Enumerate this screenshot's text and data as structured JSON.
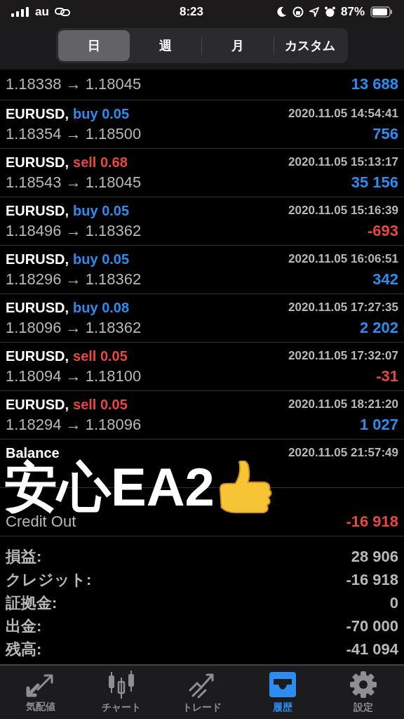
{
  "status_bar": {
    "carrier": "au",
    "time": "8:23",
    "battery": "87%"
  },
  "period_tabs": [
    {
      "label": "日",
      "selected": true
    },
    {
      "label": "週",
      "selected": false
    },
    {
      "label": "月",
      "selected": false
    },
    {
      "label": "カスタム",
      "selected": false
    }
  ],
  "partial_row": {
    "prices": "1.18338 → 1.18045",
    "profit": "13 688",
    "loss": false
  },
  "trades": [
    {
      "kind": "trade",
      "symbol": "EURUSD,",
      "sell": false,
      "volume": "buy 0.05",
      "time": "2020.11.05 14:54:41",
      "prices": "1.18354 → 1.18500",
      "profit": "756",
      "loss": false
    },
    {
      "kind": "trade",
      "symbol": "EURUSD,",
      "sell": true,
      "volume": "sell 0.68",
      "time": "2020.11.05 15:13:17",
      "prices": "1.18543 → 1.18045",
      "profit": "35 156",
      "loss": false
    },
    {
      "kind": "trade",
      "symbol": "EURUSD,",
      "sell": false,
      "volume": "buy 0.05",
      "time": "2020.11.05 15:16:39",
      "prices": "1.18496 → 1.18362",
      "profit": "-693",
      "loss": true
    },
    {
      "kind": "trade",
      "symbol": "EURUSD,",
      "sell": false,
      "volume": "buy 0.05",
      "time": "2020.11.05 16:06:51",
      "prices": "1.18296 → 1.18362",
      "profit": "342",
      "loss": false
    },
    {
      "kind": "trade",
      "symbol": "EURUSD,",
      "sell": false,
      "volume": "buy 0.08",
      "time": "2020.11.05 17:27:35",
      "prices": "1.18096 → 1.18362",
      "profit": "2 202",
      "loss": false
    },
    {
      "kind": "trade",
      "symbol": "EURUSD,",
      "sell": true,
      "volume": "sell 0.05",
      "time": "2020.11.05 17:32:07",
      "prices": "1.18094 → 1.18100",
      "profit": "-31",
      "loss": true
    },
    {
      "kind": "trade",
      "symbol": "EURUSD,",
      "sell": true,
      "volume": "sell 0.05",
      "time": "2020.11.05 18:21:20",
      "prices": "1.18294 → 1.18096",
      "profit": "1 027",
      "loss": false
    },
    {
      "kind": "balance",
      "symbol": "Balance",
      "time": "2020.11.05 21:57:49"
    },
    {
      "kind": "balance",
      "prices": "Credit Out",
      "profit": "-16 918",
      "loss": true
    }
  ],
  "summary": [
    {
      "label": "損益:",
      "value": "28 906"
    },
    {
      "label": "クレジット:",
      "value": "-16 918"
    },
    {
      "label": "証拠金:",
      "value": "0"
    },
    {
      "label": "出金:",
      "value": "-70 000"
    },
    {
      "label": "残高:",
      "value": "-41 094"
    }
  ],
  "caption": "安心EA2",
  "tab_bar": [
    {
      "label": "気配値",
      "selected": false
    },
    {
      "label": "チャート",
      "selected": false
    },
    {
      "label": "トレード",
      "selected": false
    },
    {
      "label": "履歴",
      "selected": true
    },
    {
      "label": "設定",
      "selected": false
    }
  ]
}
